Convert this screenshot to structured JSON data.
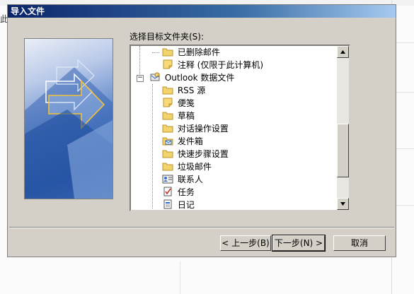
{
  "background": {
    "left_text": "此"
  },
  "dialog": {
    "title": "导入文件",
    "folder_label": "选择目标文件夹(S):",
    "tree": [
      {
        "label": "已删除邮件",
        "icon": "folder-icon",
        "level": 2
      },
      {
        "label": "注释 (仅限于此计算机)",
        "icon": "note-icon",
        "level": 2
      },
      {
        "label": "Outlook 数据文件",
        "icon": "outlook-datafile-icon",
        "level": 1,
        "expanded": true
      },
      {
        "label": "RSS 源",
        "icon": "folder-icon",
        "level": 2
      },
      {
        "label": "便笺",
        "icon": "note-icon",
        "level": 2
      },
      {
        "label": "草稿",
        "icon": "folder-icon",
        "level": 2
      },
      {
        "label": "对话操作设置",
        "icon": "folder-icon",
        "level": 2
      },
      {
        "label": "发件箱",
        "icon": "outbox-icon",
        "level": 2
      },
      {
        "label": "快速步骤设置",
        "icon": "folder-icon",
        "level": 2
      },
      {
        "label": "垃圾邮件",
        "icon": "folder-icon",
        "level": 2
      },
      {
        "label": "联系人",
        "icon": "contacts-icon",
        "level": 2
      },
      {
        "label": "任务",
        "icon": "tasks-icon",
        "level": 2
      },
      {
        "label": "日记",
        "icon": "journal-icon",
        "level": 2
      }
    ],
    "buttons": {
      "back": "< 上一步(B)",
      "next": "下一步(N) >",
      "cancel": "取消"
    }
  },
  "colors": {
    "dialog_bg": "#d4d0c8",
    "title_gradient_start": "#0a246a",
    "folder_yellow": "#f3d36b",
    "note_yellow": "#f7d978"
  }
}
